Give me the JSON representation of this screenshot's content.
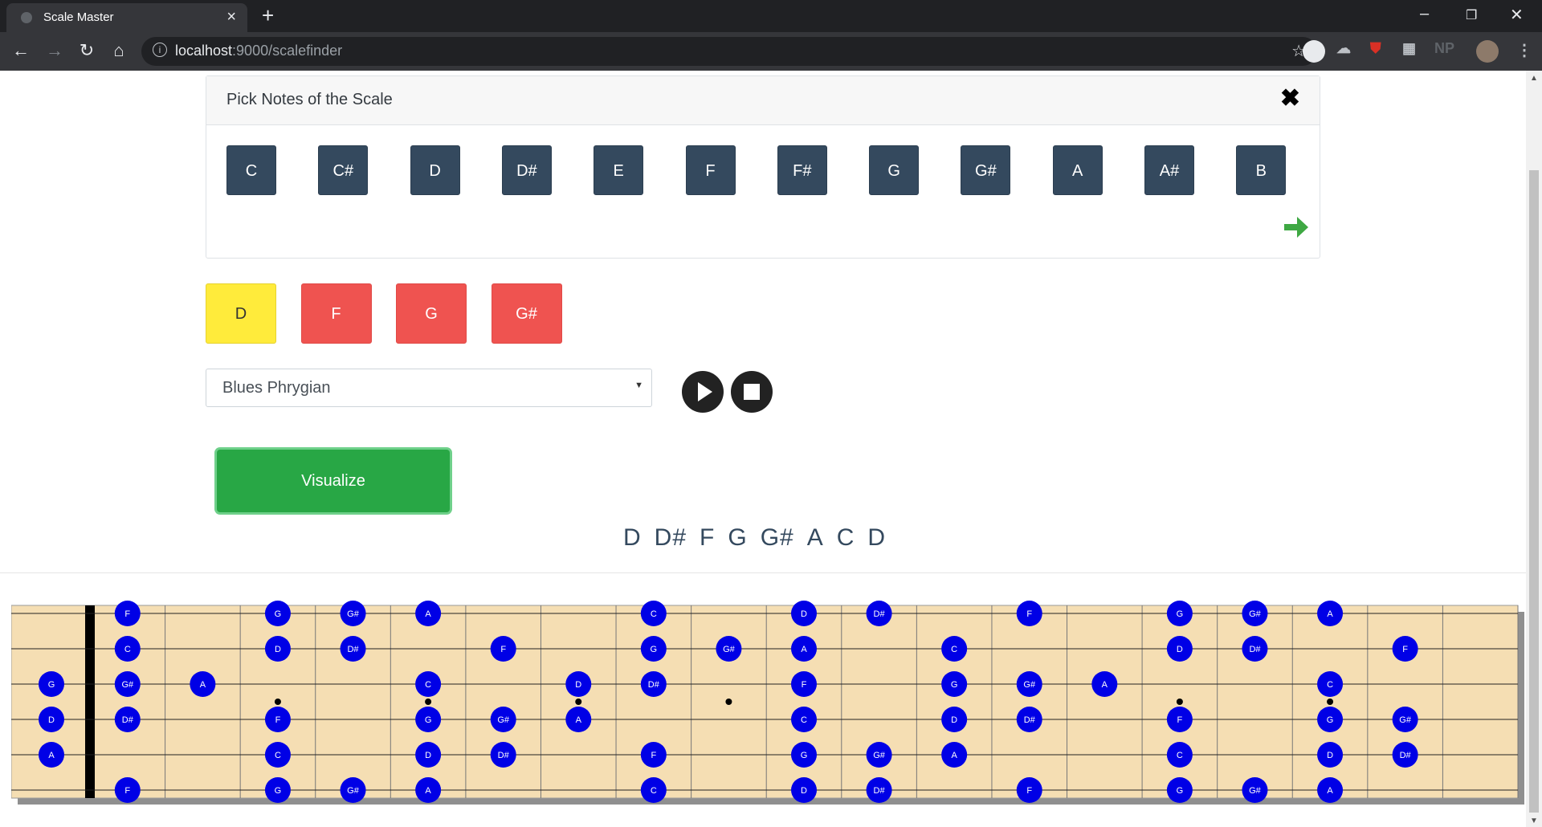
{
  "browser": {
    "tab_title": "Scale Master",
    "url_host": "localhost",
    "url_path": ":9000/scalefinder",
    "extensions": [
      "NP"
    ]
  },
  "picker": {
    "title": "Pick Notes of the Scale",
    "notes": [
      "C",
      "C#",
      "D",
      "D#",
      "E",
      "F",
      "F#",
      "G",
      "G#",
      "A",
      "A#",
      "B"
    ]
  },
  "selected_notes": [
    {
      "label": "D",
      "color": "#ffeb3b"
    },
    {
      "label": "F",
      "color": "#ef5350"
    },
    {
      "label": "G",
      "color": "#ef5350"
    },
    {
      "label": "G#",
      "color": "#ef5350"
    }
  ],
  "scale_select": {
    "value": "Blues Phrygian"
  },
  "visualize_label": "Visualize",
  "scale_notes": [
    "D",
    "D#",
    "F",
    "G",
    "G#",
    "A",
    "C",
    "D"
  ],
  "fretboard": {
    "strings": [
      "E",
      "B",
      "G",
      "D",
      "A",
      "E"
    ],
    "fret_count": 19,
    "marker_dot_color": "#0000e6",
    "wood_color": "#f5deb3",
    "open_notes": [
      {
        "string": 2,
        "note": "G"
      },
      {
        "string": 3,
        "note": "D"
      },
      {
        "string": 4,
        "note": "A"
      }
    ],
    "notes": [
      [
        1,
        "F"
      ],
      [
        3,
        "G"
      ],
      [
        4,
        "G#"
      ],
      [
        5,
        "A"
      ],
      [
        8,
        "C"
      ],
      [
        10,
        "D"
      ],
      [
        11,
        "D#"
      ],
      [
        13,
        "F"
      ],
      [
        15,
        "G"
      ],
      [
        16,
        "G#"
      ],
      [
        17,
        "A"
      ],
      [
        1,
        "C"
      ],
      [
        3,
        "D"
      ],
      [
        4,
        "D#"
      ],
      [
        6,
        "F"
      ],
      [
        8,
        "G"
      ],
      [
        9,
        "G#"
      ],
      [
        10,
        "A"
      ],
      [
        12,
        "C"
      ],
      [
        15,
        "D"
      ],
      [
        16,
        "D#"
      ],
      [
        18,
        "F"
      ],
      [
        1,
        "G#"
      ],
      [
        2,
        "A"
      ],
      [
        5,
        "C"
      ],
      [
        7,
        "D"
      ],
      [
        8,
        "D#"
      ],
      [
        10,
        "F"
      ],
      [
        12,
        "G"
      ],
      [
        13,
        "G#"
      ],
      [
        14,
        "A"
      ],
      [
        17,
        "C"
      ],
      [
        1,
        "D#"
      ],
      [
        3,
        "F"
      ],
      [
        5,
        "G"
      ],
      [
        6,
        "G#"
      ],
      [
        7,
        "A"
      ],
      [
        10,
        "C"
      ],
      [
        12,
        "D"
      ],
      [
        13,
        "D#"
      ],
      [
        15,
        "F"
      ],
      [
        17,
        "G"
      ],
      [
        18,
        "G#"
      ],
      [
        3,
        "C"
      ],
      [
        5,
        "D"
      ],
      [
        6,
        "D#"
      ],
      [
        8,
        "F"
      ],
      [
        10,
        "G"
      ],
      [
        11,
        "G#"
      ],
      [
        12,
        "A"
      ],
      [
        15,
        "C"
      ],
      [
        17,
        "D"
      ],
      [
        18,
        "D#"
      ],
      [
        1,
        "F"
      ],
      [
        3,
        "G"
      ],
      [
        4,
        "G#"
      ],
      [
        5,
        "A"
      ],
      [
        8,
        "C"
      ],
      [
        10,
        "D"
      ],
      [
        11,
        "D#"
      ],
      [
        13,
        "F"
      ],
      [
        15,
        "G"
      ],
      [
        16,
        "G#"
      ],
      [
        17,
        "A"
      ]
    ],
    "string_index": [
      0,
      0,
      0,
      0,
      0,
      0,
      0,
      0,
      0,
      0,
      0,
      1,
      1,
      1,
      1,
      1,
      1,
      1,
      1,
      1,
      1,
      1,
      2,
      2,
      2,
      2,
      2,
      2,
      2,
      2,
      2,
      2,
      3,
      3,
      3,
      3,
      3,
      3,
      3,
      3,
      3,
      3,
      3,
      4,
      4,
      4,
      4,
      4,
      4,
      4,
      4,
      4,
      4,
      5,
      5,
      5,
      5,
      5,
      5,
      5,
      5,
      5,
      5,
      5
    ],
    "inlay_frets": [
      3,
      5,
      7,
      9,
      12,
      15,
      17
    ]
  }
}
